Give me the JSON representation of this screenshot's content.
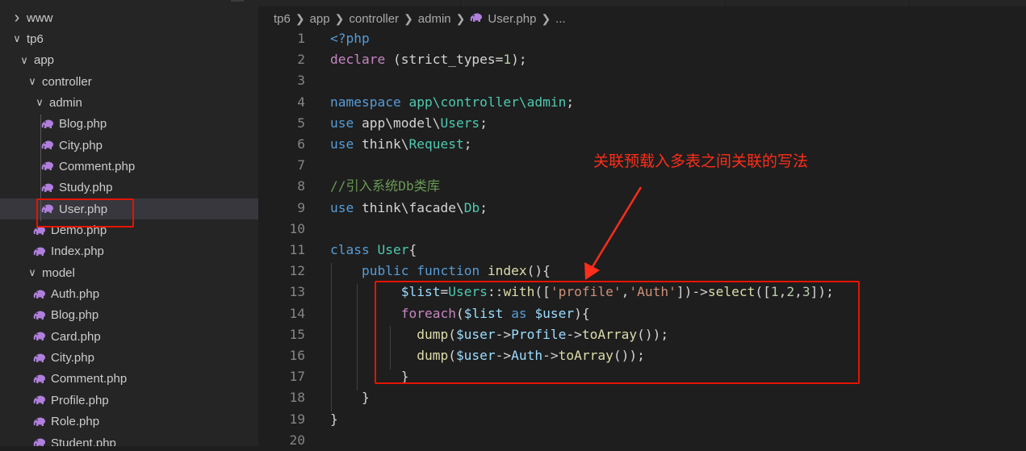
{
  "explorer": {
    "items": [
      {
        "label": "www",
        "kind": "folder",
        "expanded": false,
        "depth": 0
      },
      {
        "label": "tp6",
        "kind": "folder",
        "expanded": true,
        "depth": 0
      },
      {
        "label": "app",
        "kind": "folder",
        "expanded": true,
        "depth": 1
      },
      {
        "label": "controller",
        "kind": "folder",
        "expanded": true,
        "depth": 2
      },
      {
        "label": "admin",
        "kind": "folder",
        "expanded": true,
        "depth": 3
      },
      {
        "label": "Blog.php",
        "kind": "php",
        "depth": 4
      },
      {
        "label": "City.php",
        "kind": "php",
        "depth": 4
      },
      {
        "label": "Comment.php",
        "kind": "php",
        "depth": 4
      },
      {
        "label": "Study.php",
        "kind": "php",
        "depth": 4
      },
      {
        "label": "User.php",
        "kind": "php",
        "depth": 4,
        "selected": true
      },
      {
        "label": "Demo.php",
        "kind": "php",
        "depth": 3
      },
      {
        "label": "Index.php",
        "kind": "php",
        "depth": 3
      },
      {
        "label": "model",
        "kind": "folder",
        "expanded": true,
        "depth": 2
      },
      {
        "label": "Auth.php",
        "kind": "php",
        "depth": 3
      },
      {
        "label": "Blog.php",
        "kind": "php",
        "depth": 3
      },
      {
        "label": "Card.php",
        "kind": "php",
        "depth": 3
      },
      {
        "label": "City.php",
        "kind": "php",
        "depth": 3
      },
      {
        "label": "Comment.php",
        "kind": "php",
        "depth": 3
      },
      {
        "label": "Profile.php",
        "kind": "php",
        "depth": 3
      },
      {
        "label": "Role.php",
        "kind": "php",
        "depth": 3
      },
      {
        "label": "Student.php",
        "kind": "php",
        "depth": 3
      }
    ]
  },
  "breadcrumb": {
    "parts": [
      "tp6",
      "app",
      "controller",
      "admin"
    ],
    "file": "User.php",
    "ellipsis": "..."
  },
  "editor": {
    "lines": [
      {
        "num": "1",
        "tokens": [
          [
            "kw",
            "<?php"
          ]
        ]
      },
      {
        "num": "2",
        "tokens": [
          [
            "ctl",
            "declare"
          ],
          [
            "",
            " (strict_types="
          ],
          [
            "num",
            "1"
          ],
          [
            "",
            ");"
          ]
        ]
      },
      {
        "num": "3",
        "tokens": []
      },
      {
        "num": "4",
        "tokens": [
          [
            "kw",
            "namespace"
          ],
          [
            "",
            " "
          ],
          [
            "cls",
            "app\\controller\\admin"
          ],
          [
            "",
            ";"
          ]
        ]
      },
      {
        "num": "5",
        "tokens": [
          [
            "kw",
            "use"
          ],
          [
            "",
            " app\\model\\"
          ],
          [
            "cls",
            "Users"
          ],
          [
            "",
            ";"
          ]
        ]
      },
      {
        "num": "6",
        "tokens": [
          [
            "kw",
            "use"
          ],
          [
            "",
            " think\\"
          ],
          [
            "cls",
            "Request"
          ],
          [
            "",
            ";"
          ]
        ]
      },
      {
        "num": "7",
        "tokens": []
      },
      {
        "num": "8",
        "tokens": [
          [
            "cmt",
            "//引入系统Db类库"
          ]
        ]
      },
      {
        "num": "9",
        "tokens": [
          [
            "kw",
            "use"
          ],
          [
            "",
            " think\\facade\\"
          ],
          [
            "cls",
            "Db"
          ],
          [
            "",
            ";"
          ]
        ]
      },
      {
        "num": "10",
        "tokens": []
      },
      {
        "num": "11",
        "tokens": [
          [
            "kw",
            "class"
          ],
          [
            "",
            " "
          ],
          [
            "cls",
            "User"
          ],
          [
            "",
            "{"
          ]
        ]
      },
      {
        "num": "12",
        "tokens": [
          [
            "",
            "    "
          ],
          [
            "kw",
            "public"
          ],
          [
            "",
            " "
          ],
          [
            "kw",
            "function"
          ],
          [
            "",
            " "
          ],
          [
            "fn",
            "index"
          ],
          [
            "",
            "(){"
          ]
        ]
      },
      {
        "num": "13",
        "tokens": [
          [
            "",
            "         "
          ],
          [
            "var",
            "$list"
          ],
          [
            "",
            "="
          ],
          [
            "cls",
            "Users"
          ],
          [
            "",
            "::"
          ],
          [
            "fn",
            "with"
          ],
          [
            "",
            "(["
          ],
          [
            "str",
            "'profile'"
          ],
          [
            "",
            ","
          ],
          [
            "str",
            "'Auth'"
          ],
          [
            "",
            "])->"
          ],
          [
            "fn",
            "select"
          ],
          [
            "",
            "(["
          ],
          [
            "num",
            "1"
          ],
          [
            "",
            ","
          ],
          [
            "num",
            "2"
          ],
          [
            "",
            ","
          ],
          [
            "num",
            "3"
          ],
          [
            "",
            "]);"
          ]
        ]
      },
      {
        "num": "14",
        "tokens": [
          [
            "",
            "         "
          ],
          [
            "ctl",
            "foreach"
          ],
          [
            "",
            "("
          ],
          [
            "var",
            "$list"
          ],
          [
            "",
            " "
          ],
          [
            "kw",
            "as"
          ],
          [
            "",
            " "
          ],
          [
            "var",
            "$user"
          ],
          [
            "",
            "){"
          ]
        ]
      },
      {
        "num": "15",
        "tokens": [
          [
            "",
            "           "
          ],
          [
            "fn",
            "dump"
          ],
          [
            "",
            "("
          ],
          [
            "var",
            "$user"
          ],
          [
            "",
            "->"
          ],
          [
            "var",
            "Profile"
          ],
          [
            "",
            "->"
          ],
          [
            "fn",
            "toArray"
          ],
          [
            "",
            "());"
          ]
        ]
      },
      {
        "num": "16",
        "tokens": [
          [
            "",
            "           "
          ],
          [
            "fn",
            "dump"
          ],
          [
            "",
            "("
          ],
          [
            "var",
            "$user"
          ],
          [
            "",
            "->"
          ],
          [
            "var",
            "Auth"
          ],
          [
            "",
            "->"
          ],
          [
            "fn",
            "toArray"
          ],
          [
            "",
            "());"
          ]
        ]
      },
      {
        "num": "17",
        "tokens": [
          [
            "",
            "         }"
          ]
        ]
      },
      {
        "num": "18",
        "tokens": [
          [
            "",
            "    }"
          ]
        ]
      },
      {
        "num": "19",
        "tokens": [
          [
            "",
            "}"
          ]
        ]
      },
      {
        "num": "20",
        "tokens": []
      }
    ]
  },
  "annotation": {
    "text": "关联预载入多表之间关联的写法",
    "color": "#ff2d1a"
  },
  "colors": {
    "sidebar_bg": "#252526",
    "editor_bg": "#1e1e1e",
    "highlight_red": "#e51400",
    "php_icon": "#b07fdd"
  }
}
